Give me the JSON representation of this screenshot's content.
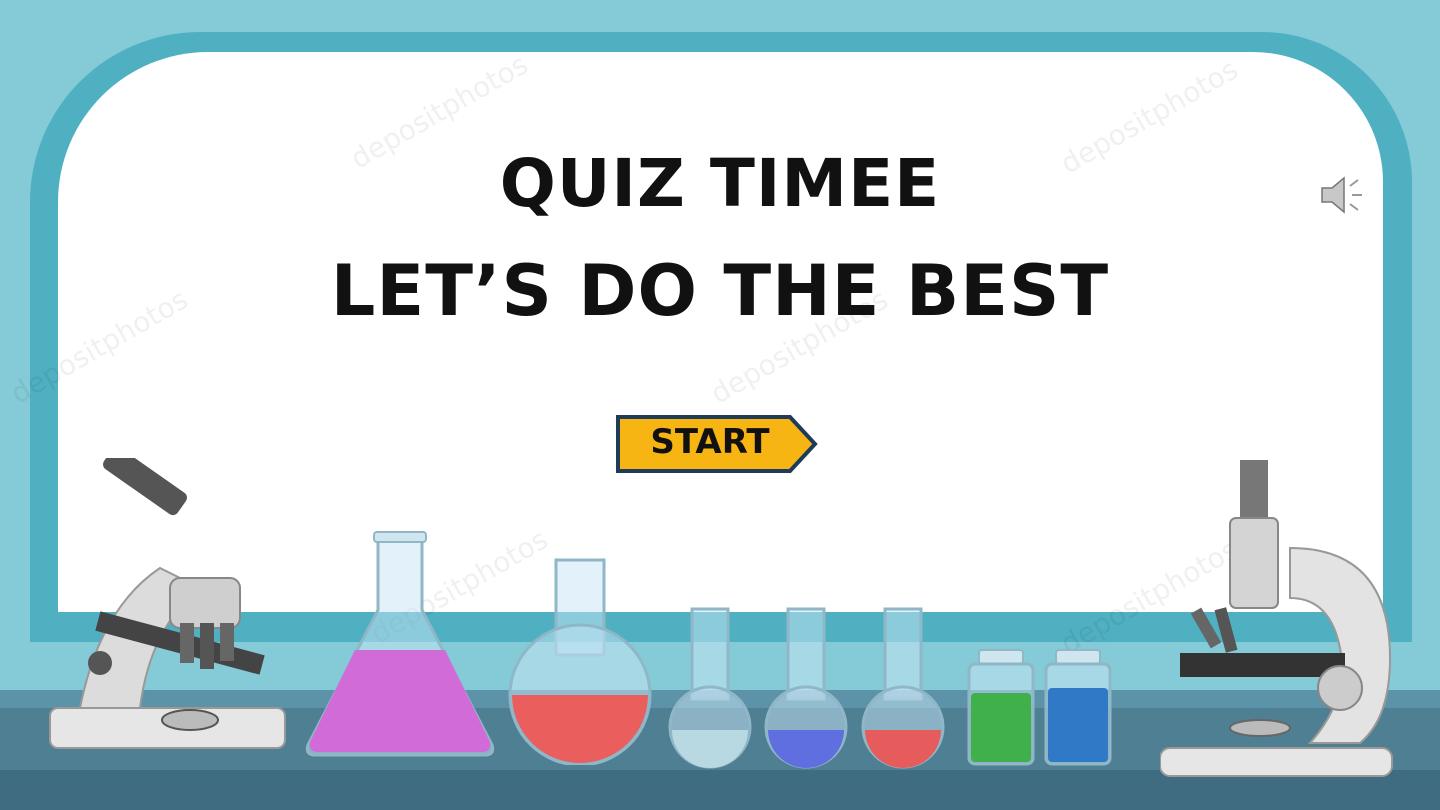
{
  "slide": {
    "title_line1": "QUIZ TIMEE",
    "title_line2": "LET’S DO THE BEST",
    "start_label": "START"
  },
  "watermark": "depositphotos",
  "colors": {
    "frame": "#84cad7",
    "board_border": "#4fb0c2",
    "counter": "#4f7f93",
    "start_fill": "#f7b514",
    "start_border": "#1f3b5a"
  },
  "icons": [
    "speaker-icon"
  ],
  "equipment": [
    "microscope-left",
    "erlenmeyer-flask-purple",
    "round-flask-red",
    "test-tube-clear",
    "test-tube-blue",
    "test-tube-red",
    "reagent-bottle-green",
    "reagent-bottle-blue",
    "microscope-right"
  ]
}
